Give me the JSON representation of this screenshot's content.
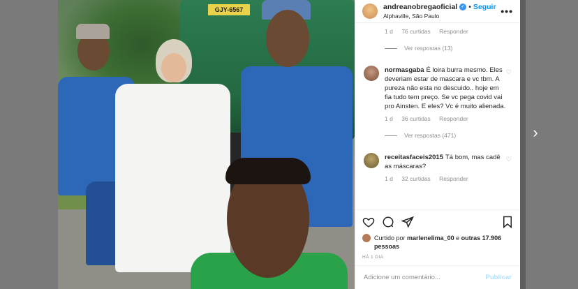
{
  "post": {
    "username": "andreanobregaoficial",
    "follow_label": "Seguir",
    "separator": "•",
    "location": "Alphaville, São Paulo",
    "more": "•••",
    "truck_plate": "GJY-6567"
  },
  "comments": {
    "first_meta": {
      "age": "1 d",
      "likes": "76 curtidas",
      "reply": "Responder"
    },
    "first_replies": "Ver respostas (13)",
    "items": [
      {
        "user": "normasgaba",
        "text": "É loira burra mesmo. Eles deveriam estar de mascara e vc tbm. A pureza não esta no descuido.. hoje em fia tudo tem preço. Se vc pega covid vai pro Ainsten. E eles? Vc é muito alienada.",
        "age": "1 d",
        "likes": "36 curtidas",
        "reply": "Responder",
        "replies": "Ver respostas (471)"
      },
      {
        "user": "receitasfaceis2015",
        "text": "Tá bom, mas cadê as máscaras?",
        "age": "1 d",
        "likes": "32 curtidas",
        "reply": "Responder"
      }
    ]
  },
  "likes": {
    "prefix": "Curtido por",
    "user": "marlenelima_00",
    "connector": "e",
    "others": "outras 17.906 pessoas"
  },
  "time_ago": "HÁ 1 DIA",
  "add_comment": {
    "placeholder": "Adicione um comentário...",
    "post_label": "Publicar"
  },
  "nav": {
    "next": "›"
  },
  "colors": {
    "link_blue": "#0095f6",
    "verified_blue": "#3897f0",
    "muted": "#8e8e8e",
    "disabled_post": "#b2dffc"
  }
}
